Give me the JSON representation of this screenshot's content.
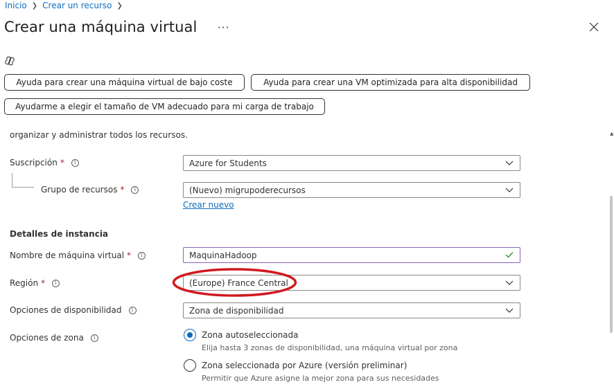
{
  "breadcrumb": {
    "items": [
      "Inicio",
      "Crear un recurso"
    ]
  },
  "page": {
    "title": "Crear una máquina virtual",
    "more": "···"
  },
  "help_buttons": [
    "Ayuda para crear una máquina virtual de bajo coste",
    "Ayuda para crear una VM optimizada para alta disponibilidad",
    "Ayudarme a elegir el tamaño de VM adecuado para mi carga de trabajo"
  ],
  "clipped_text": "organizar y administrar todos los recursos.",
  "form": {
    "subscription": {
      "label": "Suscripción",
      "required": "*",
      "value": "Azure for Students"
    },
    "resource_group": {
      "label": "Grupo de recursos",
      "required": "*",
      "value": "(Nuevo) migrupoderecursos",
      "create_link": "Crear nuevo"
    },
    "instance_section": "Detalles de instancia",
    "vm_name": {
      "label": "Nombre de máquina virtual",
      "required": "*",
      "value": "MaquinaHadoop"
    },
    "region": {
      "label": "Región",
      "required": "*",
      "value": "(Europe) France Central"
    },
    "availability": {
      "label": "Opciones de disponibilidad",
      "value": "Zona de disponibilidad"
    },
    "zone_options": {
      "label": "Opciones de zona",
      "options": [
        {
          "label": "Zona autoseleccionada",
          "desc": "Elija hasta 3 zonas de disponibilidad, una máquina virtual por zona",
          "selected": true
        },
        {
          "label": "Zona seleccionada por Azure (versión preliminar)",
          "desc": "Permitir que Azure asigne la mejor zona para sus necesidades",
          "selected": false
        }
      ]
    }
  },
  "colors": {
    "accent": "#0f6cbd",
    "required": "#a4262c",
    "annotation": "#d0191f",
    "valid": "#107c10"
  },
  "icons": [
    "chevron-right-icon",
    "close-icon",
    "copilot-icon",
    "info-icon",
    "chevron-down-icon",
    "checkmark-icon"
  ]
}
